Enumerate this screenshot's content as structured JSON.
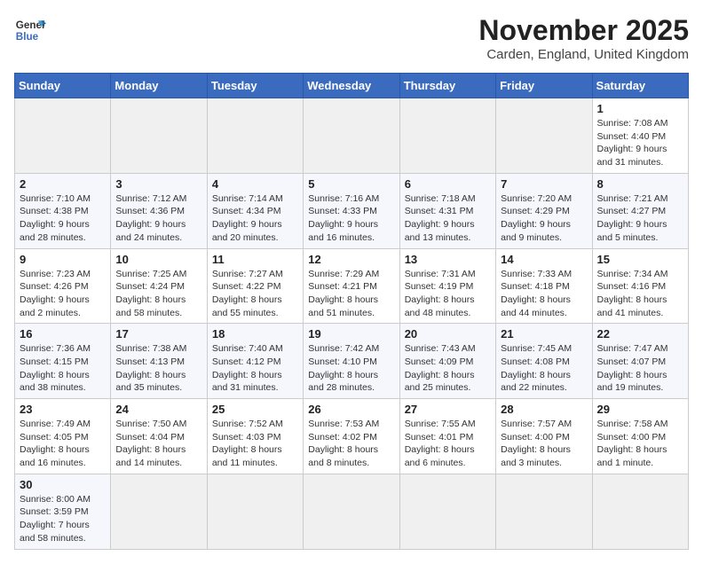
{
  "logo": {
    "line1": "General",
    "line2": "Blue"
  },
  "title": "November 2025",
  "subtitle": "Carden, England, United Kingdom",
  "days_of_week": [
    "Sunday",
    "Monday",
    "Tuesday",
    "Wednesday",
    "Thursday",
    "Friday",
    "Saturday"
  ],
  "weeks": [
    [
      {
        "day": "",
        "info": ""
      },
      {
        "day": "",
        "info": ""
      },
      {
        "day": "",
        "info": ""
      },
      {
        "day": "",
        "info": ""
      },
      {
        "day": "",
        "info": ""
      },
      {
        "day": "",
        "info": ""
      },
      {
        "day": "1",
        "info": "Sunrise: 7:08 AM\nSunset: 4:40 PM\nDaylight: 9 hours and 31 minutes."
      }
    ],
    [
      {
        "day": "2",
        "info": "Sunrise: 7:10 AM\nSunset: 4:38 PM\nDaylight: 9 hours and 28 minutes."
      },
      {
        "day": "3",
        "info": "Sunrise: 7:12 AM\nSunset: 4:36 PM\nDaylight: 9 hours and 24 minutes."
      },
      {
        "day": "4",
        "info": "Sunrise: 7:14 AM\nSunset: 4:34 PM\nDaylight: 9 hours and 20 minutes."
      },
      {
        "day": "5",
        "info": "Sunrise: 7:16 AM\nSunset: 4:33 PM\nDaylight: 9 hours and 16 minutes."
      },
      {
        "day": "6",
        "info": "Sunrise: 7:18 AM\nSunset: 4:31 PM\nDaylight: 9 hours and 13 minutes."
      },
      {
        "day": "7",
        "info": "Sunrise: 7:20 AM\nSunset: 4:29 PM\nDaylight: 9 hours and 9 minutes."
      },
      {
        "day": "8",
        "info": "Sunrise: 7:21 AM\nSunset: 4:27 PM\nDaylight: 9 hours and 5 minutes."
      }
    ],
    [
      {
        "day": "9",
        "info": "Sunrise: 7:23 AM\nSunset: 4:26 PM\nDaylight: 9 hours and 2 minutes."
      },
      {
        "day": "10",
        "info": "Sunrise: 7:25 AM\nSunset: 4:24 PM\nDaylight: 8 hours and 58 minutes."
      },
      {
        "day": "11",
        "info": "Sunrise: 7:27 AM\nSunset: 4:22 PM\nDaylight: 8 hours and 55 minutes."
      },
      {
        "day": "12",
        "info": "Sunrise: 7:29 AM\nSunset: 4:21 PM\nDaylight: 8 hours and 51 minutes."
      },
      {
        "day": "13",
        "info": "Sunrise: 7:31 AM\nSunset: 4:19 PM\nDaylight: 8 hours and 48 minutes."
      },
      {
        "day": "14",
        "info": "Sunrise: 7:33 AM\nSunset: 4:18 PM\nDaylight: 8 hours and 44 minutes."
      },
      {
        "day": "15",
        "info": "Sunrise: 7:34 AM\nSunset: 4:16 PM\nDaylight: 8 hours and 41 minutes."
      }
    ],
    [
      {
        "day": "16",
        "info": "Sunrise: 7:36 AM\nSunset: 4:15 PM\nDaylight: 8 hours and 38 minutes."
      },
      {
        "day": "17",
        "info": "Sunrise: 7:38 AM\nSunset: 4:13 PM\nDaylight: 8 hours and 35 minutes."
      },
      {
        "day": "18",
        "info": "Sunrise: 7:40 AM\nSunset: 4:12 PM\nDaylight: 8 hours and 31 minutes."
      },
      {
        "day": "19",
        "info": "Sunrise: 7:42 AM\nSunset: 4:10 PM\nDaylight: 8 hours and 28 minutes."
      },
      {
        "day": "20",
        "info": "Sunrise: 7:43 AM\nSunset: 4:09 PM\nDaylight: 8 hours and 25 minutes."
      },
      {
        "day": "21",
        "info": "Sunrise: 7:45 AM\nSunset: 4:08 PM\nDaylight: 8 hours and 22 minutes."
      },
      {
        "day": "22",
        "info": "Sunrise: 7:47 AM\nSunset: 4:07 PM\nDaylight: 8 hours and 19 minutes."
      }
    ],
    [
      {
        "day": "23",
        "info": "Sunrise: 7:49 AM\nSunset: 4:05 PM\nDaylight: 8 hours and 16 minutes."
      },
      {
        "day": "24",
        "info": "Sunrise: 7:50 AM\nSunset: 4:04 PM\nDaylight: 8 hours and 14 minutes."
      },
      {
        "day": "25",
        "info": "Sunrise: 7:52 AM\nSunset: 4:03 PM\nDaylight: 8 hours and 11 minutes."
      },
      {
        "day": "26",
        "info": "Sunrise: 7:53 AM\nSunset: 4:02 PM\nDaylight: 8 hours and 8 minutes."
      },
      {
        "day": "27",
        "info": "Sunrise: 7:55 AM\nSunset: 4:01 PM\nDaylight: 8 hours and 6 minutes."
      },
      {
        "day": "28",
        "info": "Sunrise: 7:57 AM\nSunset: 4:00 PM\nDaylight: 8 hours and 3 minutes."
      },
      {
        "day": "29",
        "info": "Sunrise: 7:58 AM\nSunset: 4:00 PM\nDaylight: 8 hours and 1 minute."
      }
    ],
    [
      {
        "day": "30",
        "info": "Sunrise: 8:00 AM\nSunset: 3:59 PM\nDaylight: 7 hours and 58 minutes."
      },
      {
        "day": "",
        "info": ""
      },
      {
        "day": "",
        "info": ""
      },
      {
        "day": "",
        "info": ""
      },
      {
        "day": "",
        "info": ""
      },
      {
        "day": "",
        "info": ""
      },
      {
        "day": "",
        "info": ""
      }
    ]
  ]
}
